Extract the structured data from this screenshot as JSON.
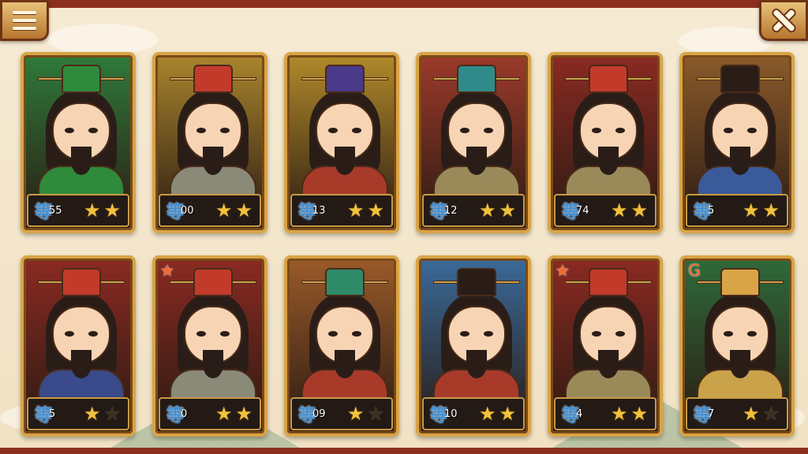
{
  "toolbar": {
    "menu_icon": "hamburger-menu-icon",
    "close_icon": "close-x-icon"
  },
  "colors": {
    "frame": "#8c2f1f",
    "parchment": "#f4e6cb",
    "card_border": "#d9a445",
    "star_on": "#f2c13c",
    "star_off": "#3c3022",
    "level_badge": "#3f8fd4"
  },
  "level_glyph": "等",
  "heroes": [
    {
      "level": "55",
      "stars": 2,
      "max_stars": 2,
      "bg": "#2f7a3a",
      "hat": "#2f8a3c",
      "armor": "#2f8a3c",
      "emblem": ""
    },
    {
      "level": "00",
      "stars": 2,
      "max_stars": 2,
      "bg": "#a9852d",
      "hat": "#c23a2a",
      "armor": "#8a8a78",
      "emblem": ""
    },
    {
      "level": "13",
      "stars": 2,
      "max_stars": 2,
      "bg": "#b08a2a",
      "hat": "#4a3a8a",
      "armor": "#a83a2a",
      "emblem": ""
    },
    {
      "level": "12",
      "stars": 2,
      "max_stars": 2,
      "bg": "#9c3a2a",
      "hat": "#2f8a8a",
      "armor": "#9a8a5a",
      "emblem": ""
    },
    {
      "level": "74",
      "stars": 2,
      "max_stars": 2,
      "bg": "#8a2a22",
      "hat": "#c23a2a",
      "armor": "#9a8a5a",
      "emblem": ""
    },
    {
      "level": "5",
      "stars": 2,
      "max_stars": 2,
      "bg": "#8a5a2a",
      "hat": "#2a1d18",
      "armor": "#3a5a9a",
      "emblem": ""
    },
    {
      "level": "5",
      "stars": 1,
      "max_stars": 2,
      "bg": "#8a2a22",
      "hat": "#c23a2a",
      "armor": "#3a4a8a",
      "emblem": ""
    },
    {
      "level": "0",
      "stars": 2,
      "max_stars": 2,
      "bg": "#8a2a22",
      "hat": "#c23a2a",
      "armor": "#8a8a78",
      "emblem": "★"
    },
    {
      "level": "09",
      "stars": 1,
      "max_stars": 2,
      "bg": "#9a5a2a",
      "hat": "#2f8a6a",
      "armor": "#a83a2a",
      "emblem": ""
    },
    {
      "level": "10",
      "stars": 2,
      "max_stars": 2,
      "bg": "#3a6a9a",
      "hat": "#2a1d18",
      "armor": "#a83a2a",
      "emblem": ""
    },
    {
      "level": "4",
      "stars": 2,
      "max_stars": 2,
      "bg": "#8a2a22",
      "hat": "#c23a2a",
      "armor": "#9a8a5a",
      "emblem": "★"
    },
    {
      "level": "7",
      "stars": 1,
      "max_stars": 2,
      "bg": "#2f6a3a",
      "hat": "#d9a445",
      "armor": "#caa24a",
      "emblem": "G"
    }
  ]
}
